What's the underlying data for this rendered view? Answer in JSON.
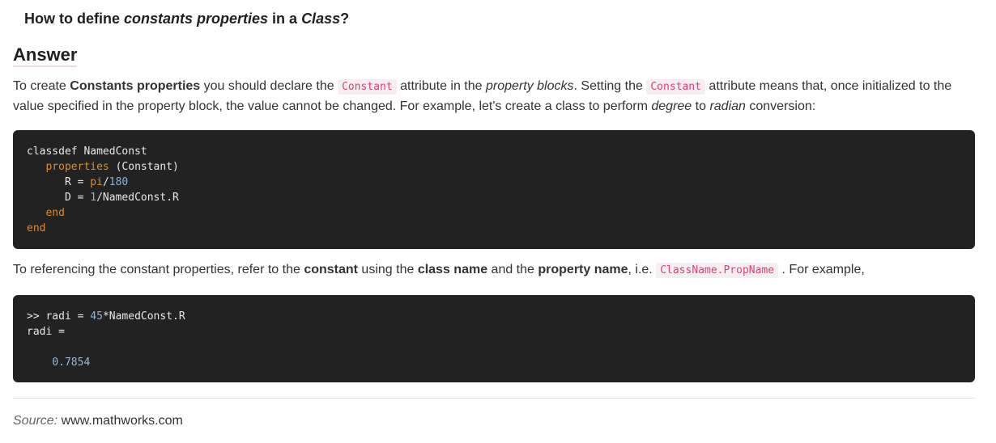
{
  "question": {
    "prefix": "How to define ",
    "em1": "constants properties",
    "middle": " in a ",
    "em2": "Class",
    "suffix": "?"
  },
  "answer_heading": "Answer",
  "paragraph1": {
    "t1": "To create ",
    "b1": "Constants properties",
    "t2": " you should declare the ",
    "code1": "Constant",
    "t3": " attribute in the ",
    "em1": "property blocks",
    "t4": ". Setting the ",
    "code2": "Constant",
    "t5": " attribute means that, once initialized to the value specified in the property block, the value cannot be changed. For example, let's create a class to perform ",
    "em2": "degree",
    "t6": " to ",
    "em3": "radian",
    "t7": " conversion:"
  },
  "code_block1": {
    "l1": "classdef NamedConst",
    "l2_indent": "   ",
    "l2_kw": "properties",
    "l2_rest": " (Constant)",
    "l3_pre": "      R = ",
    "l3_kw": "pi",
    "l3_slash": "/",
    "l3_num": "180",
    "l4_pre": "      D = ",
    "l4_num": "1",
    "l4_rest": "/NamedConst.R",
    "l5_indent": "   ",
    "l5_kw": "end",
    "l6_kw": "end"
  },
  "paragraph2": {
    "t1": "To referencing the constant properties, refer to the ",
    "b1": "constant",
    "t2": " using the ",
    "b2": "class name",
    "t3": " and the ",
    "b3": "property name",
    "t4": ", i.e. ",
    "code1": "ClassName.PropName",
    "t5": " . For example,"
  },
  "code_block2": {
    "l1_pre": ">> radi = ",
    "l1_num": "45",
    "l1_rest": "*NamedConst.R",
    "l2": "radi =",
    "l4_indent": "    ",
    "l4_num": "0.7854"
  },
  "source": {
    "label": "Source:",
    "value": " www.mathworks.com"
  },
  "colors": {
    "inline_code_text": "#e0407a",
    "inline_code_bg": "#f7eef2",
    "code_bg": "#222222",
    "keyword": "#e08a2c",
    "number": "#8fb0d6"
  }
}
